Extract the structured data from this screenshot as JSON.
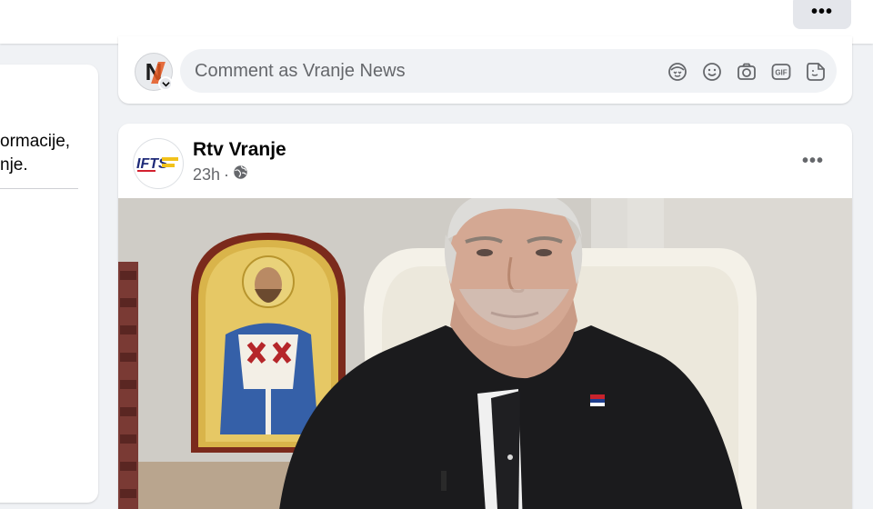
{
  "topbar": {
    "more_label": "•••"
  },
  "left_card": {
    "line1": "ormacije,",
    "line2": "nje."
  },
  "comment": {
    "placeholder": "Comment as Vranje News",
    "avatar_letter": "N",
    "icons": [
      "avatar-sticker-icon",
      "emoji-icon",
      "camera-icon",
      "gif-icon",
      "sticker-icon"
    ]
  },
  "post": {
    "author": "Rtv Vranje",
    "time": "23h",
    "separator": "·",
    "audience_icon": "globe-icon",
    "more_label": "•••",
    "avatar_logo_text": "IFTS"
  },
  "colors": {
    "page_bg": "#f0f2f5",
    "card_bg": "#ffffff",
    "secondary_text": "#65676b",
    "input_bg": "#f0f2f5"
  }
}
